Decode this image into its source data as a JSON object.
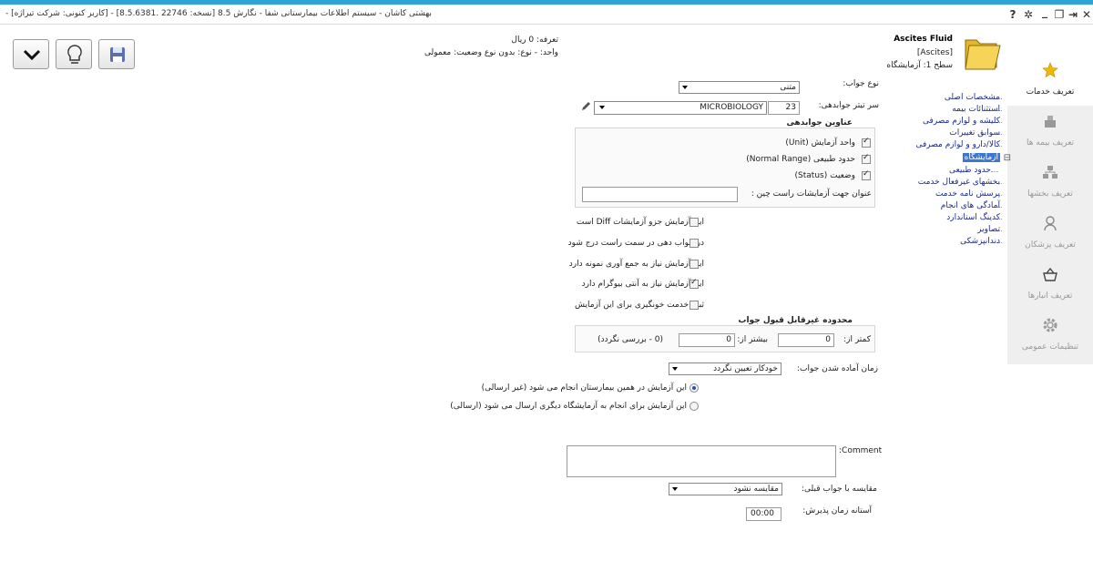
{
  "titlebar": {
    "title": "- [کاربر کنونی: شرکت تیراژه] - بهشتی کاشان - سیستم اطلاعات بیمارستانی شفا - نگارش 8.5 [نسخه: 22746 .8.5.6381]",
    "buttons": {
      "help": "?",
      "settings": "✲",
      "minimize": "_",
      "restore": "❐",
      "exit": "⇥",
      "close": "✕"
    }
  },
  "header": {
    "service_name": "Ascites Fluid",
    "service_code": "[Ascites]",
    "level": "سطح 1: آزمایشگاه",
    "tariff": "تعرفه: 0 ریال",
    "unit_type_status": "واحد: -   نوع: بدون نوع   وضعیت: معمولی"
  },
  "sidebar": {
    "items": [
      {
        "label": "تعریف خدمات",
        "icon": "star-icon"
      },
      {
        "label": "تعریف بیمه ها",
        "icon": "insurance-icon"
      },
      {
        "label": "تعریف بخشها",
        "icon": "departments-icon"
      },
      {
        "label": "تعریف پزشکان",
        "icon": "doctor-icon"
      },
      {
        "label": "تعریف انبارها",
        "icon": "basket-icon"
      },
      {
        "label": "تنظیمات عمومی",
        "icon": "gear-icon"
      }
    ]
  },
  "tree": {
    "items": [
      "مشخصات اصلی",
      "استثنائات بیمه",
      "کلیشه و لوازم مصرفی",
      "سوابق تغییرات",
      "کالا/دارو و لوازم مصرفی",
      "آزمایشگاه",
      "حدود طبیعی",
      "بخشهای غیرفعال خدمت",
      "پرسش نامه خدمت",
      "آمادگی های انجام",
      "کدینگ استاندارد",
      "تصاویر",
      "دندانپزشکی"
    ],
    "expander": "⊟"
  },
  "form": {
    "answer_type_label": "نوع جواب:",
    "answer_type_value": "متنی",
    "report_header_label": "سر تیتر جوابدهی:",
    "report_header_code": "23",
    "report_header_value": "MICROBIOLOGY",
    "report_titles_heading": "عناوین جوابدهی",
    "report_titles": [
      {
        "label": "واحد آزمایش (Unit)",
        "checked": true
      },
      {
        "label": "حدود طبیعی (Normal Range)",
        "checked": true
      },
      {
        "label": "وضعیت (Status)",
        "checked": true
      }
    ],
    "rtl_title_label": "عنوان جهت آزمایشات راست چین :",
    "rtl_title_value": "",
    "options": [
      {
        "label": "این آزمایش جزو آزمایشات Diff است",
        "checked": false
      },
      {
        "label": "در جواب دهی در سمت راست درج شود",
        "checked": false
      },
      {
        "label": "این آزمایش نیاز به جمع آوری نمونه دارد",
        "checked": false
      },
      {
        "label": "این آزمایش نیاز به آنتی بیوگرام دارد",
        "checked": true
      },
      {
        "label": "ثبت خدمت خونگیری برای این آزمایش",
        "checked": false
      }
    ],
    "unacceptable_range_heading": "محدوده غیرقابل قبول جواب",
    "less_than_label": "کمتر از:",
    "less_than_value": "0",
    "more_than_label": "بیشتر از:",
    "more_than_value": "0",
    "range_note": "(0 - بررسی نگردد)",
    "ready_time_label": "زمان آماده شدن جواب:",
    "ready_time_value": "خودکار تعیین نگردد",
    "radios": [
      {
        "label": "این آزمایش در همین بیمارستان انجام می شود (غیر ارسالی)",
        "selected": true
      },
      {
        "label": "این آزمایش برای انجام به آزمایشگاه دیگری ارسال می شود (ارسالی)",
        "selected": false
      }
    ],
    "comment_label": ":Comment",
    "comment_value": "",
    "compare_label": "مقایسه با جواب قبلی:",
    "compare_value": "مقایسه نشود",
    "threshold_label": "آستانه زمان پذیرش:",
    "threshold_value": "00:00"
  }
}
